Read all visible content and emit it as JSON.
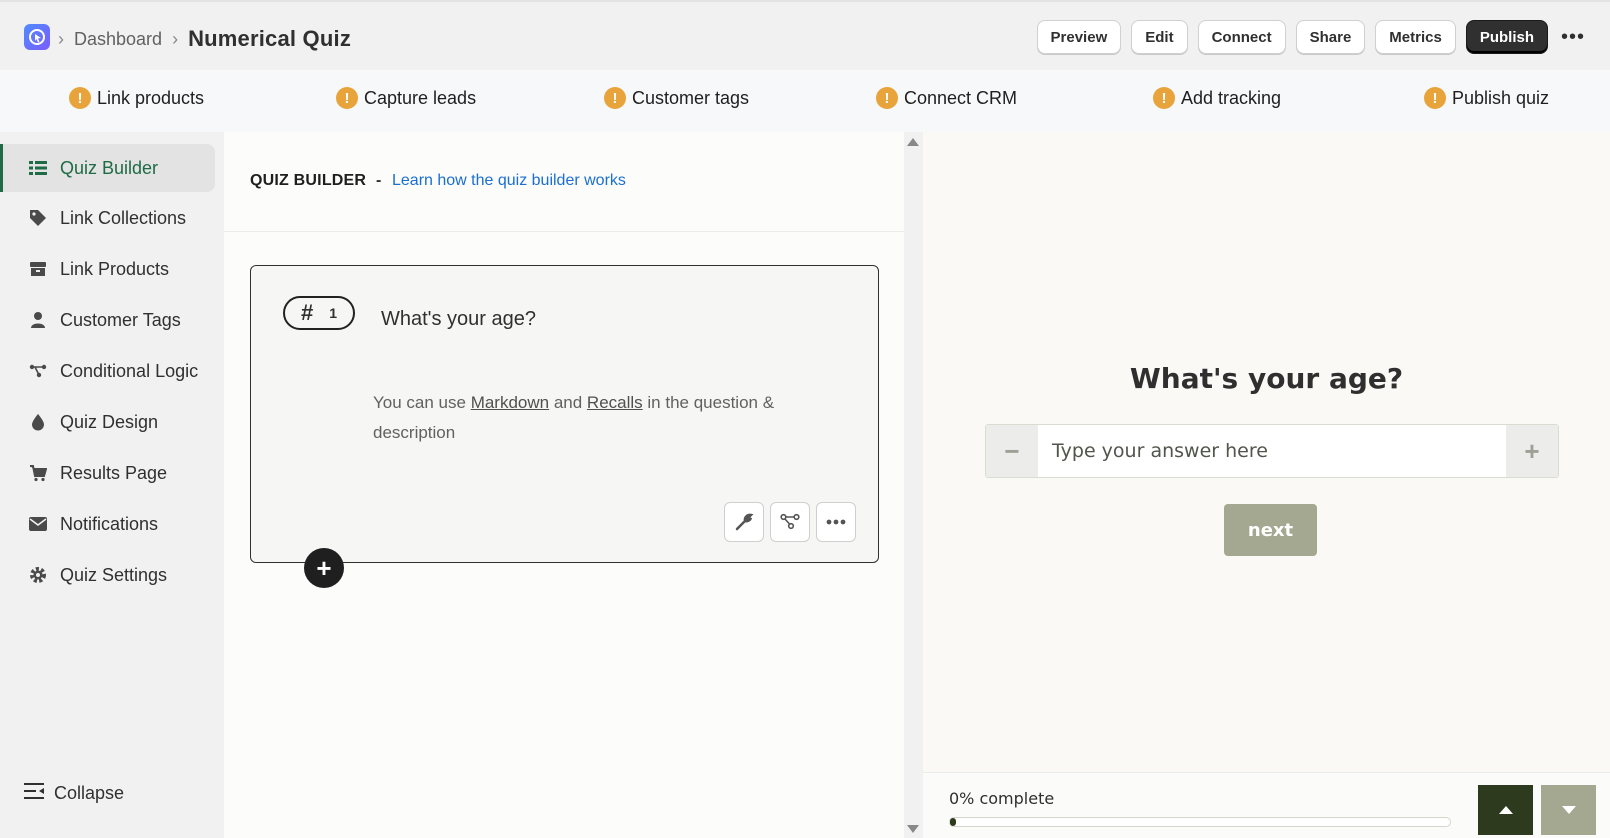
{
  "header": {
    "breadcrumb_parent": "Dashboard",
    "breadcrumb_current": "Numerical Quiz",
    "actions": {
      "preview": "Preview",
      "edit": "Edit",
      "connect": "Connect",
      "share": "Share",
      "metrics": "Metrics",
      "publish": "Publish"
    },
    "more_label": "•••"
  },
  "checklist": [
    {
      "label": "Link products"
    },
    {
      "label": "Capture leads"
    },
    {
      "label": "Customer tags"
    },
    {
      "label": "Connect CRM"
    },
    {
      "label": "Add tracking"
    },
    {
      "label": "Publish quiz"
    }
  ],
  "sidebar": {
    "items": [
      {
        "label": "Quiz Builder",
        "icon": "list-icon"
      },
      {
        "label": "Link Collections",
        "icon": "tag-icon"
      },
      {
        "label": "Link Products",
        "icon": "box-icon"
      },
      {
        "label": "Customer Tags",
        "icon": "user-icon"
      },
      {
        "label": "Conditional Logic",
        "icon": "branch-icon"
      },
      {
        "label": "Quiz Design",
        "icon": "drop-icon"
      },
      {
        "label": "Results Page",
        "icon": "cart-icon"
      },
      {
        "label": "Notifications",
        "icon": "mail-icon"
      },
      {
        "label": "Quiz Settings",
        "icon": "gear-icon"
      }
    ],
    "collapse_label": "Collapse"
  },
  "builder": {
    "heading": "QUIZ BUILDER",
    "dash": "-",
    "learn_link": "Learn how the quiz builder works",
    "question": {
      "number_symbol": "#",
      "number": "1",
      "title": "What's your age?",
      "desc_prefix": "You can use ",
      "desc_link1": "Markdown",
      "desc_mid": " and ",
      "desc_link2": "Recalls",
      "desc_suffix": " in the question & description"
    },
    "add_symbol": "+"
  },
  "preview": {
    "title": "What's your age?",
    "input_placeholder": "Type your answer here",
    "minus": "−",
    "plus": "+",
    "next_label": "next",
    "progress_label": "0% complete",
    "progress_fraction": 0.0
  },
  "colors": {
    "accent_green": "#1e6b45",
    "warning": "#e8a33a",
    "link_blue": "#1a6fd1",
    "preview_dark": "#2d3a1d",
    "preview_muted": "#a4a890"
  }
}
